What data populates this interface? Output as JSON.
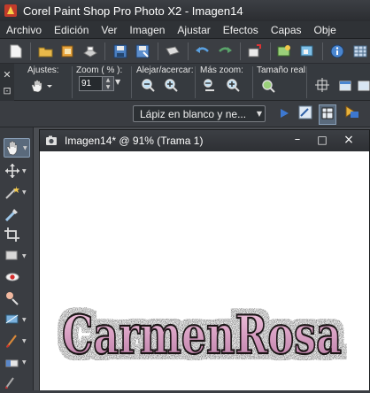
{
  "app": {
    "title": "Corel Paint Shop Pro Photo X2 - Imagen14"
  },
  "menu": {
    "items": [
      "Archivo",
      "Edición",
      "Ver",
      "Imagen",
      "Ajustar",
      "Efectos",
      "Capas",
      "Obje"
    ]
  },
  "toolbar": {
    "groups": {
      "ajustes_label": "Ajustes:",
      "zoom_label": "Zoom ( % ):",
      "alejar_label": "Alejar/acercar:",
      "mas_zoom_label": "Más zoom:",
      "tamano_label": "Tamaño real:"
    },
    "zoom_value": "91",
    "preset_value": "Lápiz en blanco y ne..."
  },
  "document": {
    "title": "Imagen14* @  91% (Trama 1)",
    "minimize": "–",
    "maximize": "□",
    "close": "×"
  },
  "artwork": {
    "text": "CarmenRosa"
  },
  "colors": {
    "title_bg": "#2b2d31",
    "panel_bg": "#3a3d42",
    "canvas_bg": "#ffffff",
    "art_fill": "#d9a3c7",
    "art_stroke": "#1a1418"
  }
}
